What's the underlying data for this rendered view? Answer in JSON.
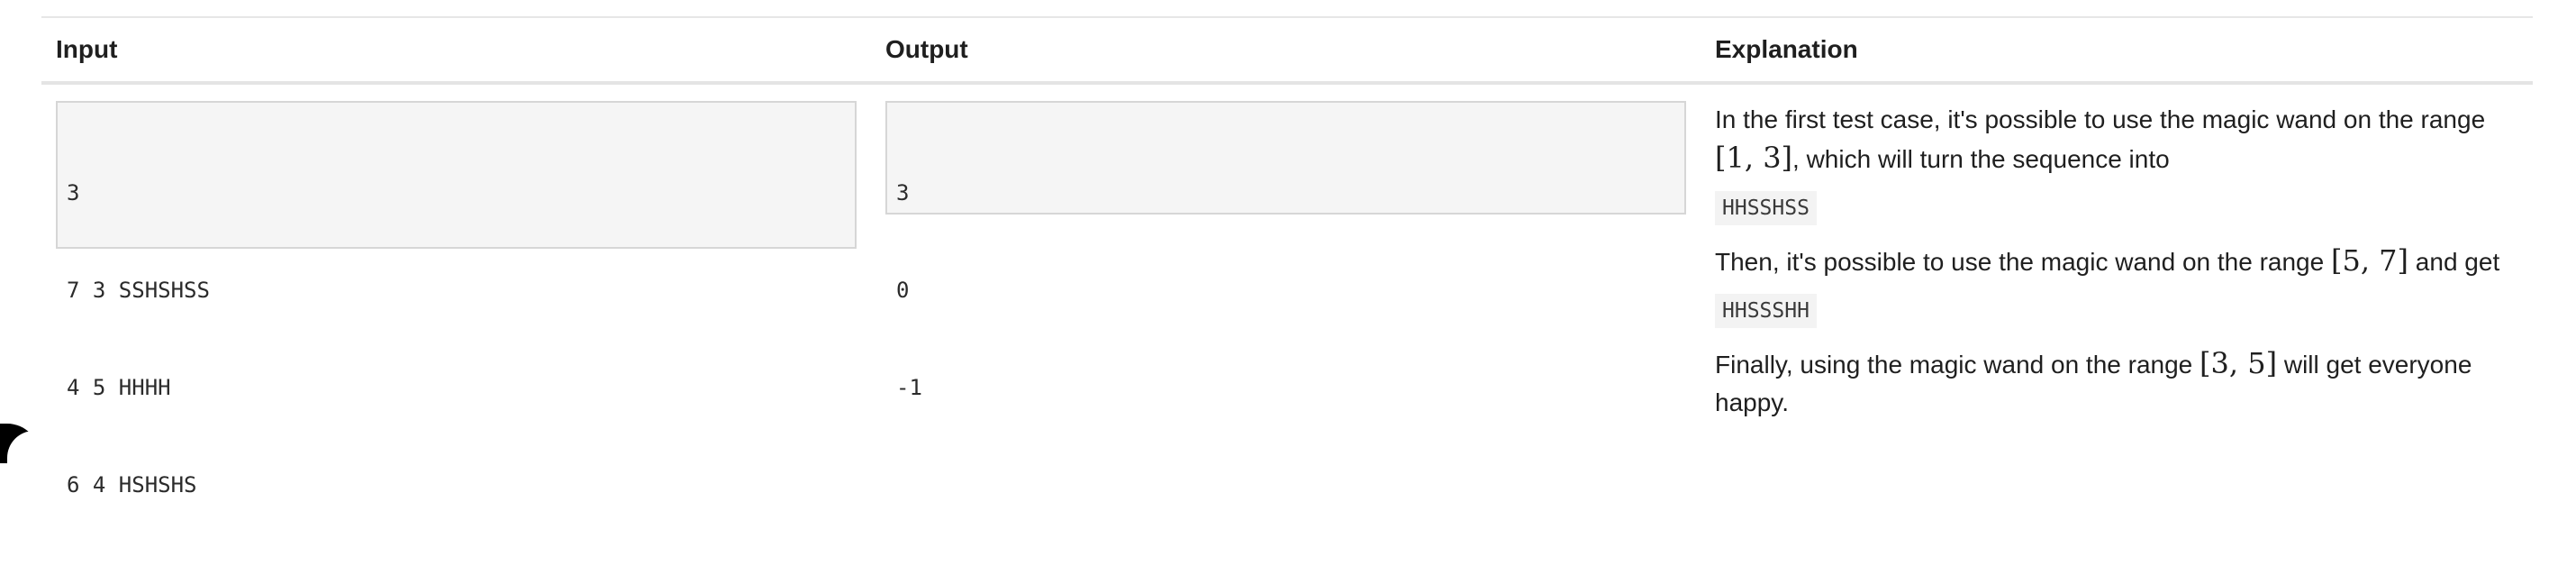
{
  "table": {
    "headers": {
      "input": "Input",
      "output": "Output",
      "explanation": "Explanation"
    }
  },
  "input_lines": [
    "3",
    "7 3 SSHSHSS",
    "4 5 HHHH",
    "6 4 HSHSHS"
  ],
  "output_lines": [
    "3",
    "0",
    "-1"
  ],
  "explanation": {
    "p1_text": "In the first test case, it's possible to use the magic wand on the range",
    "p1_math": "[1, 3]",
    "p1_tail": ", which will turn the sequence into",
    "code1": "HHSSHSS",
    "p2_text": "Then, it's possible to use the magic wand on the range",
    "p2_math": "[5, 7]",
    "p2_tail": "and get",
    "code2": "HHSSSHH",
    "p3_text": "Finally, using the magic wand on the range",
    "p3_math": "[3, 5]",
    "p3_tail": "will get everyone happy."
  }
}
